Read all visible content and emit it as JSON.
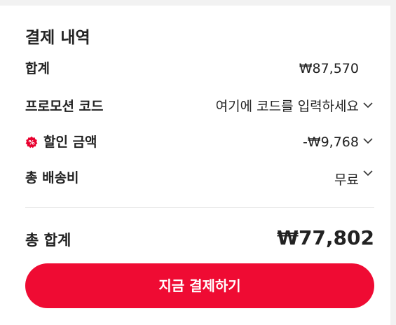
{
  "summary": {
    "title": "결제 내역",
    "subtotal": {
      "label": "합계",
      "value": "₩87,570"
    },
    "promo": {
      "label": "프로모션 코드",
      "placeholder": "여기에 코드를 입력하세요"
    },
    "discount": {
      "label": "할인 금액",
      "value": "-₩9,768",
      "icon": "discount-badge-icon",
      "color": "#e8002e"
    },
    "shipping": {
      "label": "총 배송비",
      "value": "무료"
    },
    "total": {
      "label": "총 합계",
      "value": "₩77,802"
    }
  },
  "pay_button": {
    "label": "지금 결제하기",
    "color": "#ef0b33"
  }
}
